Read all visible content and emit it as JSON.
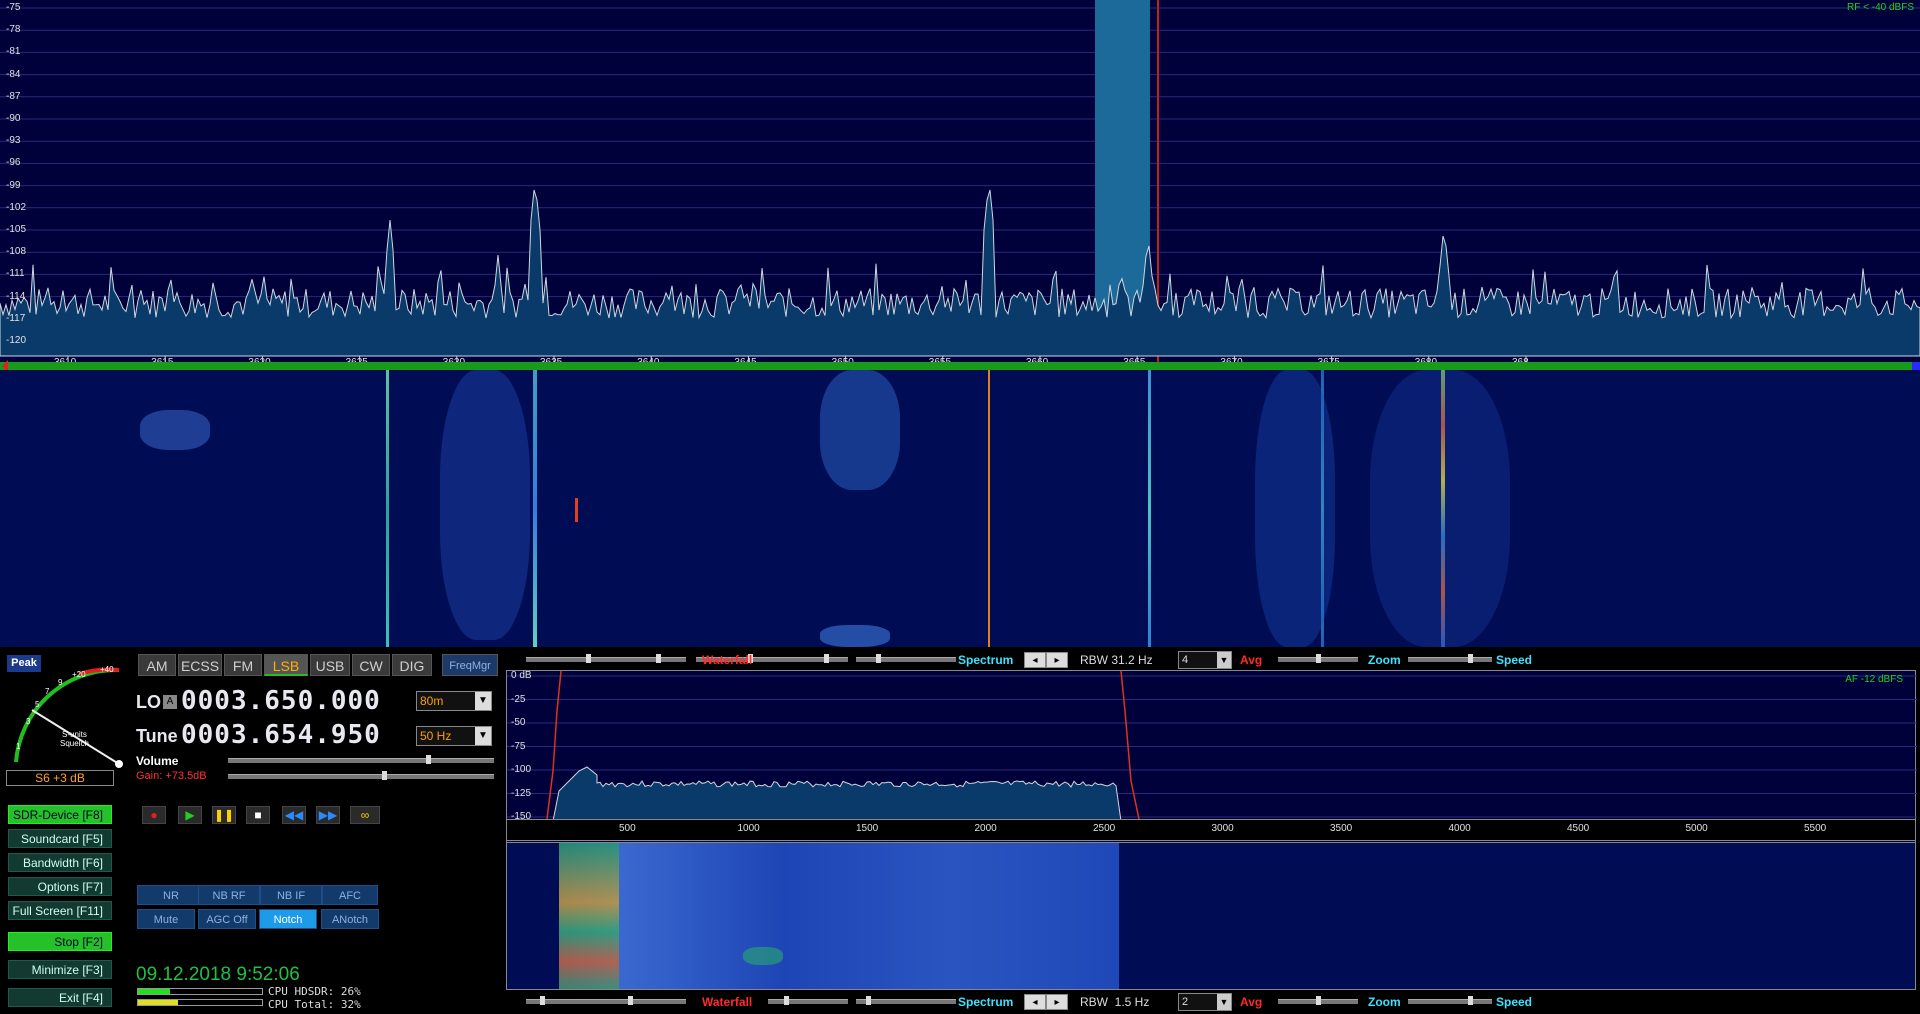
{
  "rf": {
    "db_labels": [
      "-75",
      "-78",
      "-81",
      "-84",
      "-87",
      "-90",
      "-93",
      "-96",
      "-99",
      "-102",
      "-105",
      "-108",
      "-111",
      "-114",
      "-117",
      "-120"
    ],
    "range_label": "RF < -40 dBFS",
    "freq_labels": [
      "3610",
      "3615",
      "3620",
      "3625",
      "3630",
      "3635",
      "3640",
      "3645",
      "3650",
      "3655",
      "3660",
      "3665",
      "3670",
      "3675",
      "3680",
      "368"
    ]
  },
  "rf_controls": {
    "waterfall_label": "Waterfall",
    "spectrum_label": "Spectrum",
    "rbw_label": "RBW 31.2 Hz",
    "avg_value": "4",
    "avg_label": "Avg",
    "zoom_label": "Zoom",
    "speed_label": "Speed"
  },
  "meter": {
    "peak_label": "Peak",
    "scale": [
      "1",
      "3",
      "5",
      "7",
      "9",
      "+20",
      "+40"
    ],
    "caption": "S-units\nSquelch",
    "reading": "S6 +3 dB"
  },
  "modes": [
    "AM",
    "ECSS",
    "FM",
    "LSB",
    "USB",
    "CW",
    "DIG"
  ],
  "active_mode": "LSB",
  "freqmgr_label": "FreqMgr",
  "lo": {
    "label": "LO",
    "badge": "A",
    "value": "0003.650.000",
    "band": "80m"
  },
  "tune": {
    "label": "Tune",
    "value": "0003.654.950",
    "step": "50 Hz"
  },
  "volume_label": "Volume",
  "gain_label": "Gain: +73.5dB",
  "function_buttons": [
    {
      "label": "SDR-Device [F8]",
      "active": true
    },
    {
      "label": "Soundcard [F5]",
      "active": false
    },
    {
      "label": "Bandwidth [F6]",
      "active": false
    },
    {
      "label": "Options [F7]",
      "active": false
    },
    {
      "label": "Full Screen [F11]",
      "active": false
    },
    {
      "label": "Stop [F2]",
      "active": true
    },
    {
      "label": "Minimize [F3]",
      "active": false
    },
    {
      "label": "Exit [F4]",
      "active": false
    }
  ],
  "dsp_buttons": [
    {
      "label": "NR",
      "active": false
    },
    {
      "label": "NB RF",
      "active": false
    },
    {
      "label": "NB IF",
      "active": false
    },
    {
      "label": "AFC",
      "active": false
    },
    {
      "label": "Mute",
      "active": false
    },
    {
      "label": "AGC Off",
      "active": false
    },
    {
      "label": "Notch",
      "active": true
    },
    {
      "label": "ANotch",
      "active": false
    }
  ],
  "datetime": "09.12.2018 9:52:06",
  "cpu": {
    "hdsdr": "CPU HDSDR: 26%",
    "total": "CPU Total: 32%",
    "hdsdr_fraction": 0.26,
    "total_fraction": 0.32
  },
  "af": {
    "range_label": "AF -12 dBFS",
    "db_labels": [
      "0 dB",
      "-25",
      "-50",
      "-75",
      "-100",
      "-125",
      "-150"
    ],
    "freq_labels": [
      "500",
      "1000",
      "1500",
      "2000",
      "2500",
      "3000",
      "3500",
      "4000",
      "4500",
      "5000",
      "5500"
    ]
  },
  "af_controls": {
    "waterfall_label": "Waterfall",
    "spectrum_label": "Spectrum",
    "rbw_label": "RBW  1.5 Hz",
    "avg_value": "2",
    "avg_label": "Avg",
    "zoom_label": "Zoom",
    "speed_label": "Speed"
  },
  "colors": {
    "accent_red": "#ff2a2a",
    "accent_cyan": "#40e0ff",
    "active_green": "#25c02a",
    "freq_digit": "#e8e8f0"
  }
}
